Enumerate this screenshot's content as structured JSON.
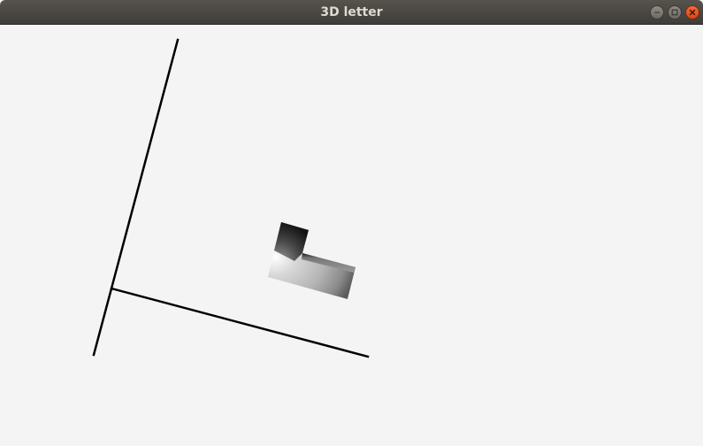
{
  "window": {
    "title": "3D letter"
  },
  "controls": {
    "minimize_icon": "minimize-icon",
    "maximize_icon": "maximize-icon",
    "close_icon": "close-icon"
  },
  "colors": {
    "titlebar": "#4a4844",
    "title_text": "#dfdbd2",
    "canvas_bg": "#f4f4f4",
    "axis": "#000000",
    "close_button": "#e95420"
  }
}
